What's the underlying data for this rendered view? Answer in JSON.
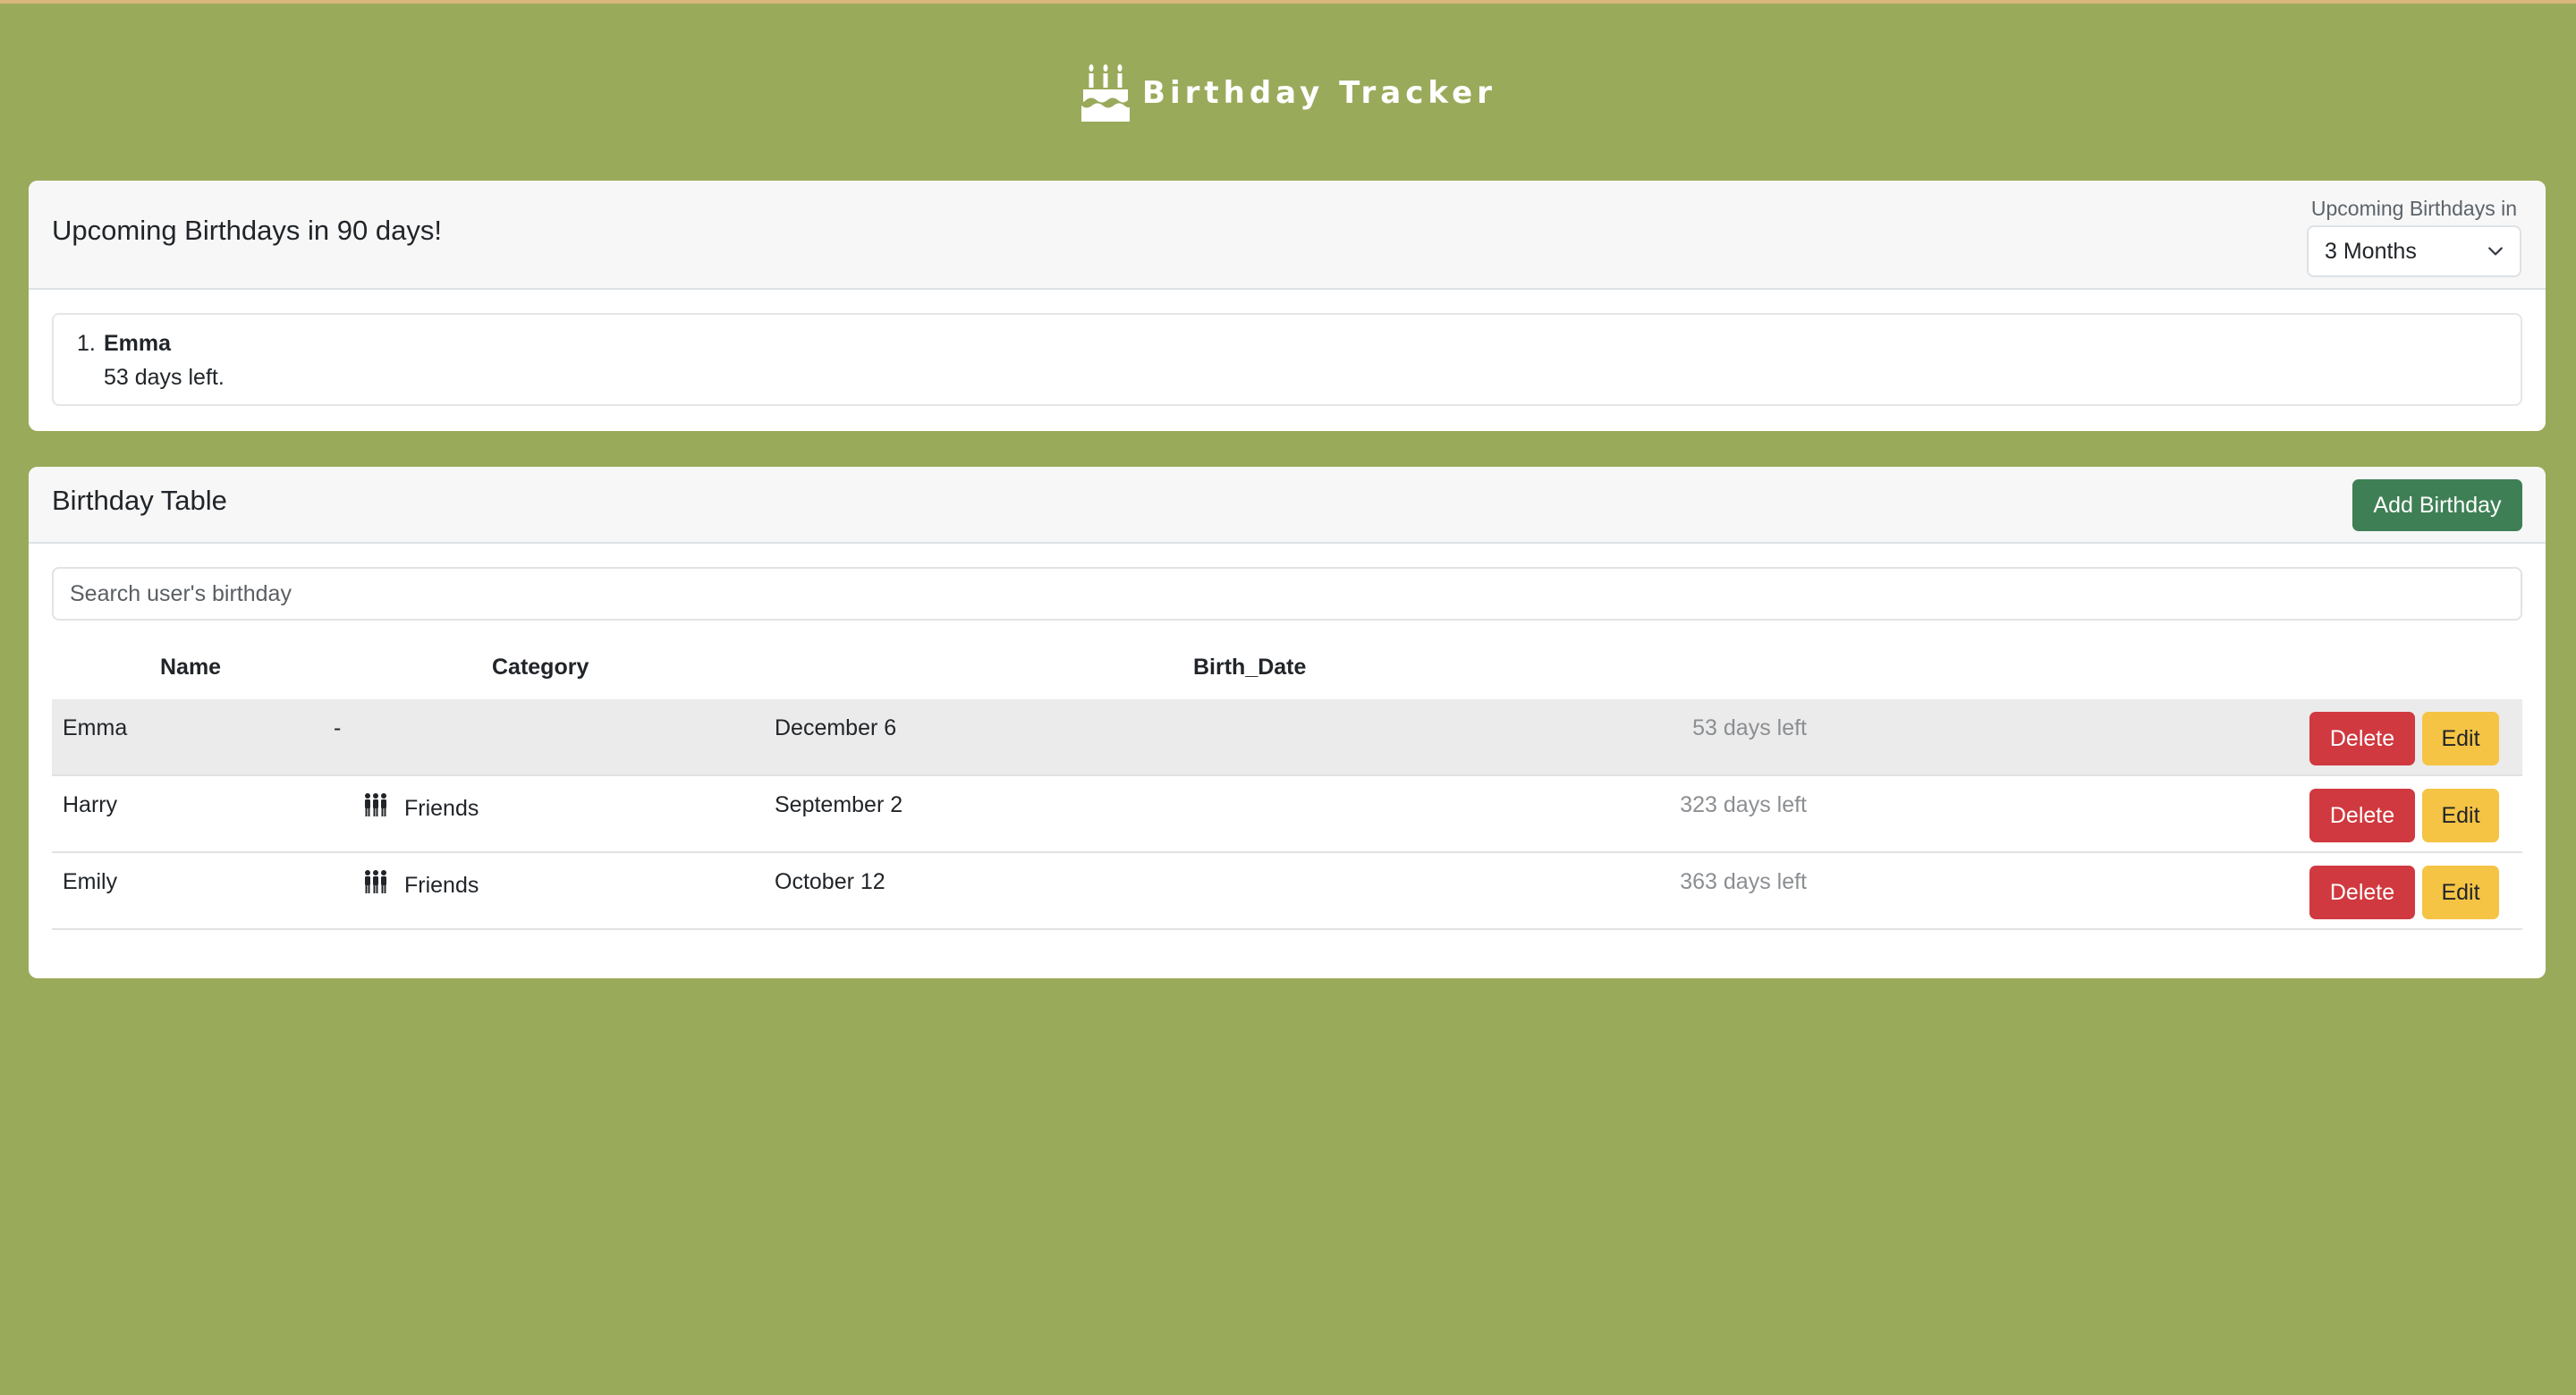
{
  "app": {
    "title": "Birthday Tracker",
    "background_color": "#9aaa5b",
    "logo_icon": "birthday-cake-icon"
  },
  "upcoming": {
    "title": "Upcoming Birthdays in 90 days!",
    "range_label": "Upcoming Birthdays in",
    "range_selected": "3 Months",
    "items": [
      {
        "index": "1.",
        "name": "Emma",
        "days_text": "53 days left."
      }
    ]
  },
  "table": {
    "title": "Birthday Table",
    "add_button_label": "Add Birthday",
    "add_button_color": "#3f7f55",
    "search_placeholder": "Search user's birthday",
    "headers": {
      "name": "Name",
      "category": "Category",
      "birth_date": "Birth_Date"
    },
    "rows": [
      {
        "name": "Emma",
        "category": "-",
        "category_icon": "",
        "birth_date": "December 6",
        "days_left": "53 days left",
        "delete_label": "Delete",
        "edit_label": "Edit",
        "highlighted": true
      },
      {
        "name": "Harry",
        "category": "Friends",
        "category_icon": "people-group-icon",
        "birth_date": "September 2",
        "days_left": "323 days left",
        "delete_label": "Delete",
        "edit_label": "Edit",
        "highlighted": false
      },
      {
        "name": "Emily",
        "category": "Friends",
        "category_icon": "people-group-icon",
        "birth_date": "October 12",
        "days_left": "363 days left",
        "delete_label": "Delete",
        "edit_label": "Edit",
        "highlighted": false
      }
    ],
    "delete_color": "#d0393f",
    "edit_color": "#f5c444"
  }
}
